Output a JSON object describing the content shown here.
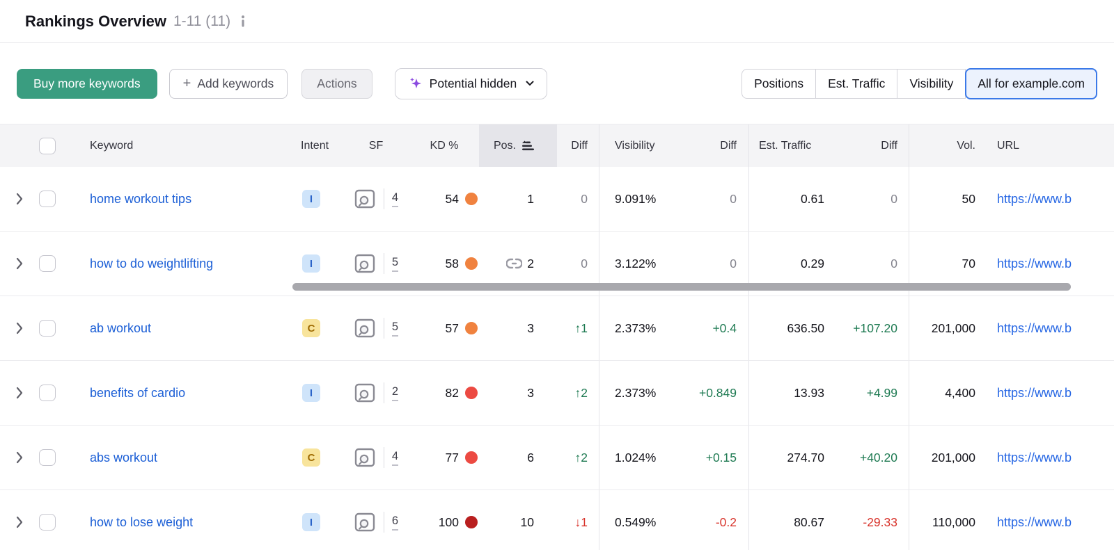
{
  "page": {
    "title": "Rankings Overview",
    "range": "1-11 (11)"
  },
  "toolbar": {
    "buy_button": "Buy more keywords",
    "add_button": "Add keywords",
    "actions_button": "Actions",
    "potential_dropdown": "Potential hidden",
    "view_tabs": [
      {
        "label": "Positions",
        "selected": false
      },
      {
        "label": "Est. Traffic",
        "selected": false
      },
      {
        "label": "Visibility",
        "selected": false
      },
      {
        "label": "All for example.com",
        "selected": true
      }
    ]
  },
  "table": {
    "headers": {
      "keyword": "Keyword",
      "intent": "Intent",
      "sf": "SF",
      "kd": "KD %",
      "pos": "Pos.",
      "pos_diff": "Diff",
      "visibility": "Visibility",
      "visibility_diff": "Diff",
      "est_traffic": "Est. Traffic",
      "traffic_diff": "Diff",
      "volume": "Vol.",
      "url": "URL"
    },
    "rows": [
      {
        "keyword": "home workout tips",
        "intent": "I",
        "sf": "4",
        "kd": "54",
        "kd_level": "orange",
        "pos": "1",
        "pos_link": false,
        "pos_diff": {
          "text": "0",
          "dir": "neutral"
        },
        "visibility": "9.091%",
        "visibility_diff": {
          "text": "0",
          "dir": "neutral"
        },
        "est_traffic": "0.61",
        "traffic_diff": {
          "text": "0",
          "dir": "neutral"
        },
        "volume": "50",
        "url": "https://www.b"
      },
      {
        "keyword": "how to do weightlifting",
        "intent": "I",
        "sf": "5",
        "kd": "58",
        "kd_level": "orange",
        "pos": "2",
        "pos_link": true,
        "pos_diff": {
          "text": "0",
          "dir": "neutral"
        },
        "visibility": "3.122%",
        "visibility_diff": {
          "text": "0",
          "dir": "neutral"
        },
        "est_traffic": "0.29",
        "traffic_diff": {
          "text": "0",
          "dir": "neutral"
        },
        "volume": "70",
        "url": "https://www.b"
      },
      {
        "keyword": "ab workout",
        "intent": "C",
        "sf": "5",
        "kd": "57",
        "kd_level": "orange",
        "pos": "3",
        "pos_link": false,
        "pos_diff": {
          "text": "↑1",
          "dir": "up"
        },
        "visibility": "2.373%",
        "visibility_diff": {
          "text": "+0.4",
          "dir": "up"
        },
        "est_traffic": "636.50",
        "traffic_diff": {
          "text": "+107.20",
          "dir": "up"
        },
        "volume": "201,000",
        "url": "https://www.b"
      },
      {
        "keyword": "benefits of cardio",
        "intent": "I",
        "sf": "2",
        "kd": "82",
        "kd_level": "red",
        "pos": "3",
        "pos_link": false,
        "pos_diff": {
          "text": "↑2",
          "dir": "up"
        },
        "visibility": "2.373%",
        "visibility_diff": {
          "text": "+0.849",
          "dir": "up"
        },
        "est_traffic": "13.93",
        "traffic_diff": {
          "text": "+4.99",
          "dir": "up"
        },
        "volume": "4,400",
        "url": "https://www.b"
      },
      {
        "keyword": "abs workout",
        "intent": "C",
        "sf": "4",
        "kd": "77",
        "kd_level": "red",
        "pos": "6",
        "pos_link": false,
        "pos_diff": {
          "text": "↑2",
          "dir": "up"
        },
        "visibility": "1.024%",
        "visibility_diff": {
          "text": "+0.15",
          "dir": "up"
        },
        "est_traffic": "274.70",
        "traffic_diff": {
          "text": "+40.20",
          "dir": "up"
        },
        "volume": "201,000",
        "url": "https://www.b"
      },
      {
        "keyword": "how to lose weight",
        "intent": "I",
        "sf": "6",
        "kd": "100",
        "kd_level": "dark_red",
        "pos": "10",
        "pos_link": false,
        "pos_diff": {
          "text": "↓1",
          "dir": "down"
        },
        "visibility": "0.549%",
        "visibility_diff": {
          "text": "-0.2",
          "dir": "down"
        },
        "est_traffic": "80.67",
        "traffic_diff": {
          "text": "-29.33",
          "dir": "down"
        },
        "volume": "110,000",
        "url": "https://www.b"
      }
    ]
  },
  "colors": {
    "accent_green": "#3a9d80",
    "keyword_link_blue": "#1c5fd6",
    "url_link_blue": "#2767e4",
    "selected_tab_border": "#3b79e8",
    "selected_tab_bg": "#ecf2fd",
    "diff_up_green": "#1e7a52",
    "diff_down_red": "#d8342c",
    "diff_neutral_gray": "#83838d",
    "kd_levels": {
      "orange": "#f0823f",
      "red": "#ec4a42",
      "dark_red": "#b91f1f"
    },
    "intent": {
      "I": {
        "bg": "#cfe4fa",
        "fg": "#2b64c9"
      },
      "C": {
        "bg": "#f8e49c",
        "fg": "#a06c04"
      }
    }
  }
}
